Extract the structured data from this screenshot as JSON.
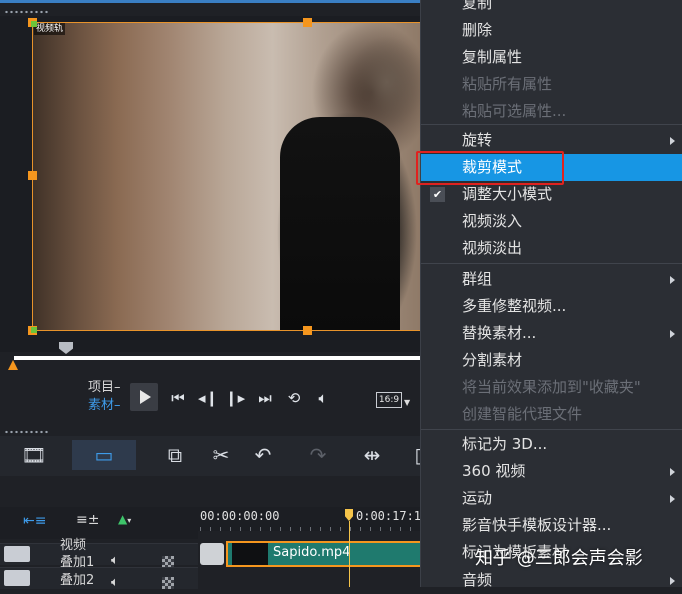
{
  "preview": {
    "video_label": "视频轨",
    "mode_project": "项目",
    "mode_clip": "素材",
    "aspect_ratio": "16:9",
    "scrub_position": 0.13
  },
  "transport": {
    "icons": [
      "play-icon",
      "skip-start-icon",
      "step-back-icon",
      "step-forward-icon",
      "skip-end-icon",
      "repeat-icon",
      "volume-icon"
    ]
  },
  "timeline": {
    "timecode_start": "00:00:00:00",
    "timecode_playhead": "0:00:17:11",
    "tracks": [
      {
        "label": "视频",
        "sub": "叠加1"
      },
      {
        "label": "叠加2"
      }
    ],
    "clip_name": "Sapido.mp4"
  },
  "menu": {
    "items": [
      {
        "label": "复制",
        "disabled": false
      },
      {
        "label": "删除",
        "disabled": false
      },
      {
        "label": "复制属性",
        "disabled": false
      },
      {
        "label": "粘贴所有属性",
        "disabled": true
      },
      {
        "label": "粘贴可选属性...",
        "disabled": true
      },
      {
        "label": "旋转",
        "disabled": false,
        "submenu": true
      },
      {
        "label": "裁剪模式",
        "disabled": false,
        "selected": true
      },
      {
        "label": "调整大小模式",
        "disabled": false,
        "checked": true
      },
      {
        "label": "视频淡入",
        "disabled": false
      },
      {
        "label": "视频淡出",
        "disabled": false
      },
      {
        "label": "群组",
        "disabled": false,
        "submenu": true
      },
      {
        "label": "多重修整视频...",
        "disabled": false
      },
      {
        "label": "替换素材...",
        "disabled": false,
        "submenu": true
      },
      {
        "label": "分割素材",
        "disabled": false
      },
      {
        "label": "将当前效果添加到\"收藏夹\"",
        "disabled": true
      },
      {
        "label": "创建智能代理文件",
        "disabled": true
      },
      {
        "label": "标记为 3D...",
        "disabled": false
      },
      {
        "label": "360 视频",
        "disabled": false,
        "submenu": true
      },
      {
        "label": "运动",
        "disabled": false,
        "submenu": true
      },
      {
        "label": "影音快手模板设计器...",
        "disabled": false
      },
      {
        "label": "标记为模板素材",
        "disabled": false
      },
      {
        "label": "音频",
        "disabled": false
      }
    ]
  },
  "watermark": "知乎 @三郎会声会影",
  "colors": {
    "accent": "#1796e4",
    "highlight_box": "#e0221f",
    "crop_handle": "#f5961e"
  }
}
